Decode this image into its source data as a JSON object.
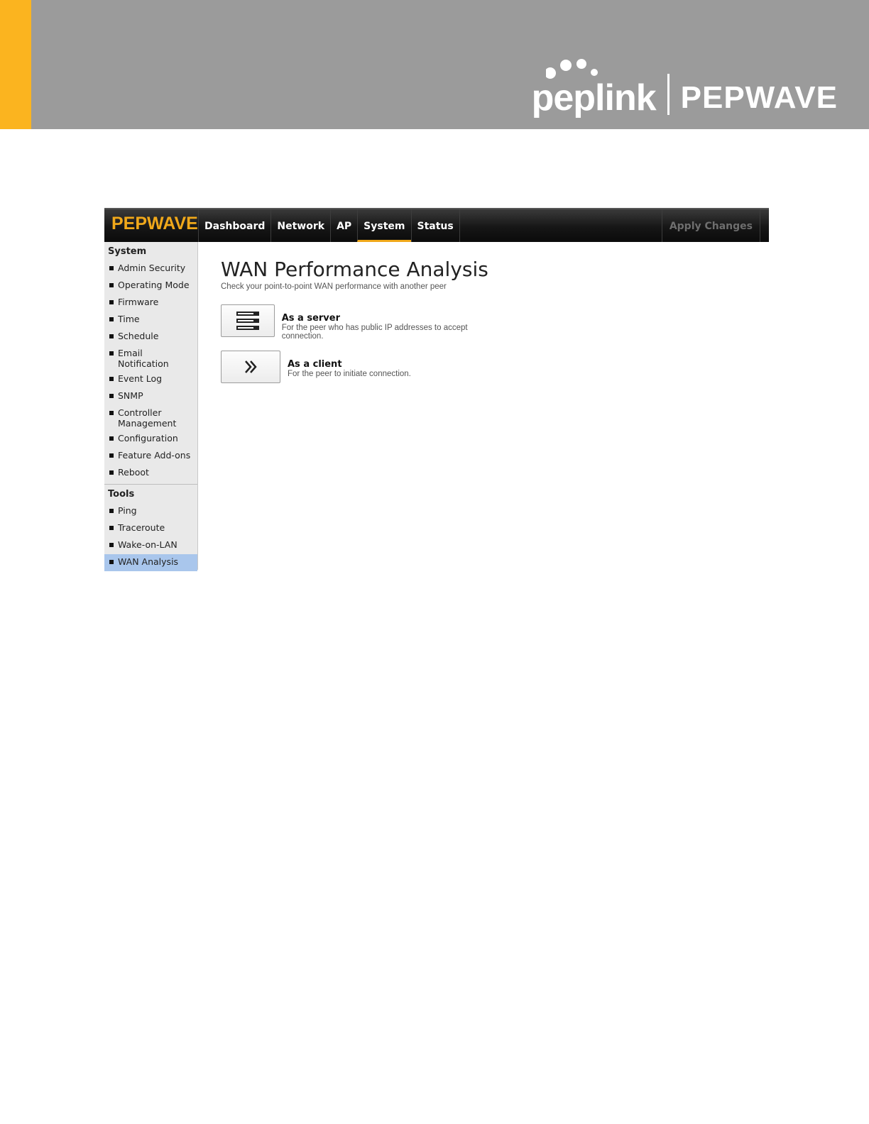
{
  "document": {
    "accent_color": "#fbb41f",
    "header_bg": "#9b9b9b",
    "brand_left": "peplink",
    "brand_right": "PEPWAVE"
  },
  "app": {
    "logo": "PEPWAVE",
    "nav_tabs": [
      "Dashboard",
      "Network",
      "AP",
      "System",
      "Status"
    ],
    "active_tab": "System",
    "apply_changes": "Apply Changes"
  },
  "sidebar": {
    "system_heading": "System",
    "system_items": [
      "Admin Security",
      "Operating Mode",
      "Firmware",
      "Time",
      "Schedule",
      "Email Notification",
      "Event Log",
      "SNMP",
      "Controller Management",
      "Configuration",
      "Feature Add-ons",
      "Reboot"
    ],
    "tools_heading": "Tools",
    "tools_items": [
      "Ping",
      "Traceroute",
      "Wake-on-LAN",
      "WAN Analysis"
    ],
    "active_item": "WAN Analysis"
  },
  "main": {
    "title": "WAN Performance Analysis",
    "subtitle": "Check your point-to-point WAN performance with another peer",
    "options": [
      {
        "icon": "server-icon",
        "title": "As a server",
        "description": "For the peer who has public IP addresses to accept connection."
      },
      {
        "icon": "double-chevron-right-icon",
        "title": "As a client",
        "description": "For the peer to initiate connection."
      }
    ]
  }
}
